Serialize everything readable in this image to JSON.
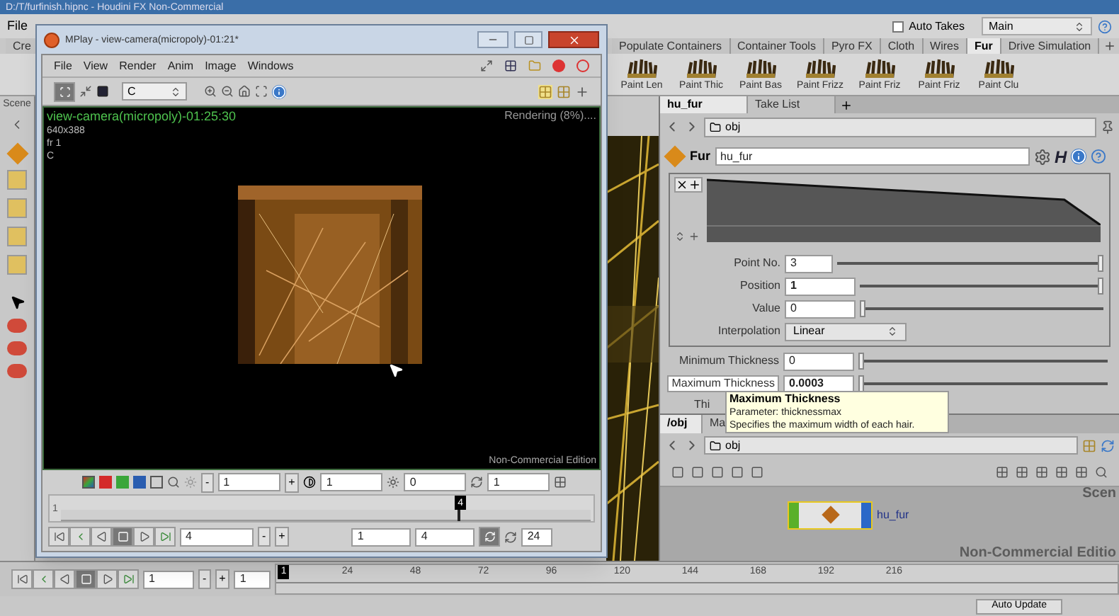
{
  "houdini": {
    "title": "D:/T/furfinish.hipnc - Houdini FX Non-Commercial",
    "menu": [
      "File"
    ],
    "auto_takes": {
      "label": "Auto Takes",
      "checked": false
    },
    "take": "Main"
  },
  "shelf": {
    "tabs": [
      {
        "label": "Cre",
        "selected": false
      },
      {
        "label": "Populate Containers",
        "selected": false
      },
      {
        "label": "Container Tools",
        "selected": false
      },
      {
        "label": "Pyro FX",
        "selected": false
      },
      {
        "label": "Cloth",
        "selected": false
      },
      {
        "label": "Wires",
        "selected": false
      },
      {
        "label": "Fur",
        "selected": true
      },
      {
        "label": "Drive Simulation",
        "selected": false
      }
    ],
    "tools": [
      "Paint Len",
      "Paint Thic",
      "Paint Bas",
      "Paint Frizz",
      "Paint Friz",
      "Paint Friz",
      "Paint Clu"
    ]
  },
  "scene_pane": {
    "label": "Scene"
  },
  "parameters": {
    "tabs": [
      {
        "label": "hu_fur",
        "selected": true
      },
      {
        "label": "Take List",
        "selected": false
      }
    ],
    "path": "obj",
    "node_type": "Fur",
    "node_name": "hu_fur",
    "help_label": "H",
    "ramp_fields": [
      {
        "label": "Point No.",
        "value": "3",
        "modified": false,
        "level": 1
      },
      {
        "label": "Position",
        "value": "1",
        "modified": true,
        "level": 1
      },
      {
        "label": "Value",
        "value": "0",
        "modified": false,
        "level": 0
      }
    ],
    "interpolation": {
      "label": "Interpolation",
      "value": "Linear"
    },
    "fields": [
      {
        "label": "Minimum Thickness",
        "value": "0",
        "modified": false,
        "highlighted": false,
        "level": 0
      },
      {
        "label": "Maximum Thickness",
        "value": "0.0003",
        "modified": true,
        "highlighted": true,
        "level": 0
      }
    ],
    "cut_label": "Thi"
  },
  "tooltip": {
    "title": "Maximum Thickness",
    "lines": [
      "Parameter: thicknessmax",
      "Specifies the maximum width of each hair."
    ]
  },
  "network": {
    "tabs": [
      {
        "label": "/obj",
        "selected": true
      },
      {
        "label": "Ma",
        "selected": false
      }
    ],
    "path": "obj",
    "context": "Scen",
    "edition": "Non-Commercial Editio",
    "node": {
      "name": "hu_fur",
      "selected": true
    }
  },
  "timeline": {
    "step": [
      "-",
      "+"
    ],
    "frame": "1",
    "start": "1",
    "current": "1",
    "ticks": [
      "24",
      "48",
      "72",
      "96",
      "120",
      "144",
      "168",
      "192",
      "216"
    ]
  },
  "status": {
    "auto_update": "Auto Update"
  },
  "mplay": {
    "title": "MPlay - view-camera(micropoly)-01:21*",
    "menu": [
      "File",
      "View",
      "Render",
      "Anim",
      "Image",
      "Windows"
    ],
    "plane": "C",
    "overlay": [
      "view-camera(micropoly)-01:25:30",
      "640x388",
      "fr 1",
      "C"
    ],
    "status": "Rendering (8%)....",
    "edition": "Non-Commercial Edition",
    "channels": [
      {
        "color": "#d42a2a"
      },
      {
        "color": "#3aa63a"
      },
      {
        "color": "#2a5db0"
      }
    ],
    "adjust_step": [
      "-",
      "+"
    ],
    "adjust": [
      "1",
      "1",
      "0",
      "1"
    ],
    "frame_slider": {
      "start": "1",
      "marker": "4",
      "level": 0.76
    },
    "playbar": {
      "step": [
        "-",
        "+"
      ],
      "frame": "4",
      "range_start": "1",
      "range_end": "4",
      "fps": "24"
    }
  }
}
